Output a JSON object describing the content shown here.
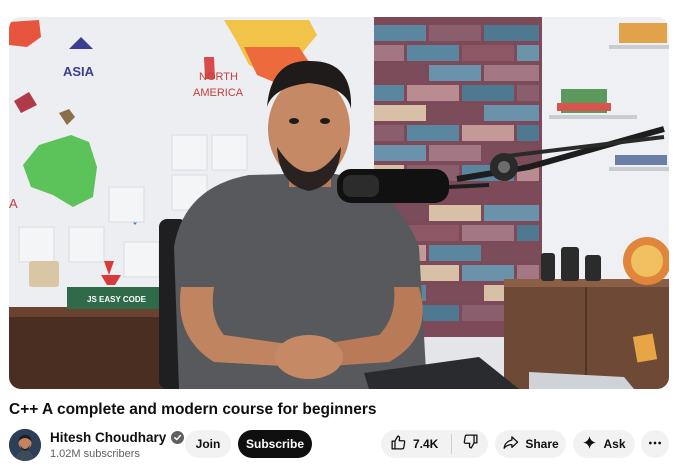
{
  "video": {
    "title": "C++ A complete and modern course for beginners",
    "scene_labels": {
      "map_asia": "ASIA",
      "map_north": "NORTH",
      "map_america": "AMERICA",
      "map_a": "A",
      "book": "JS EASY CODE"
    }
  },
  "channel": {
    "name": "Hitesh Choudhary",
    "subscribers": "1.02M subscribers",
    "join_label": "Join",
    "subscribe_label": "Subscribe"
  },
  "actions": {
    "like_count": "7.4K",
    "share_label": "Share",
    "ask_label": "Ask"
  },
  "icons": {
    "verified": "check-circle-icon",
    "like": "thumbs-up-icon",
    "dislike": "thumbs-down-icon",
    "share": "share-arrow-icon",
    "ask": "sparkle-icon",
    "more": "more-horizontal-icon"
  },
  "colors": {
    "subscribe_bg": "#0f0f0f",
    "pill_bg": "#f2f2f2",
    "secondary_text": "#606060"
  }
}
